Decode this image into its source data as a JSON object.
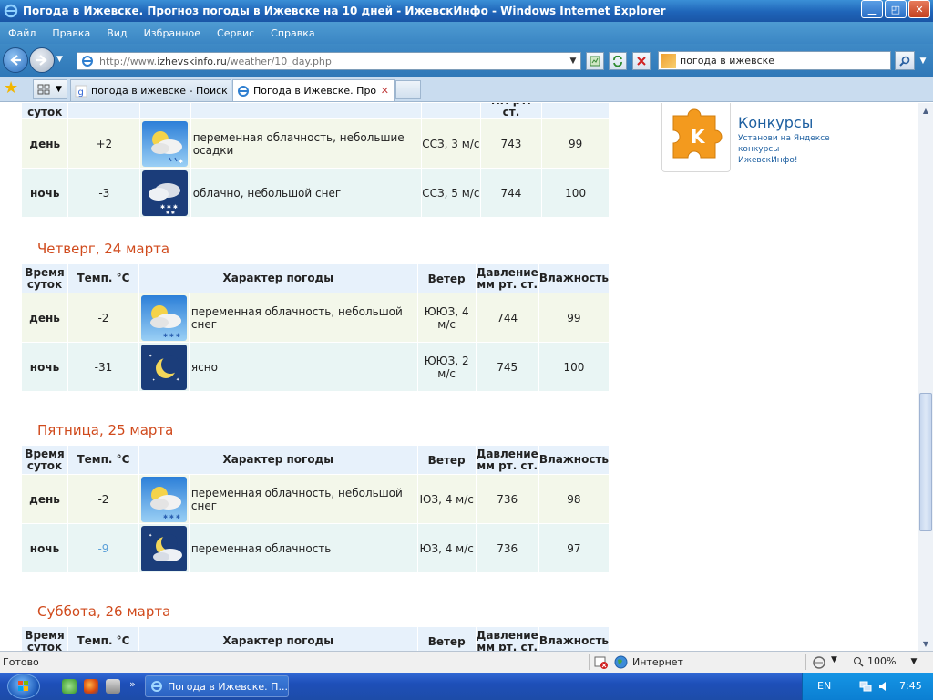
{
  "window": {
    "title": "Погода в Ижевске. Прогноз погоды в Ижевске на 10 дней - ИжевскИнфо - Windows Internet Explorer",
    "minimize": "▁",
    "maximize": "◰",
    "close": "✕"
  },
  "menu": [
    "Файл",
    "Правка",
    "Вид",
    "Избранное",
    "Сервис",
    "Справка"
  ],
  "address": {
    "url_prefix": "http://www.",
    "url_domain": "izhevskinfo.ru",
    "url_path": "/weather/10_day.php",
    "search_value": "погода в ижевске"
  },
  "tabs": [
    {
      "label": "погода в ижевске - Поиск в...",
      "active": false
    },
    {
      "label": "Погода в Ижевске. Прог...",
      "active": true
    }
  ],
  "widget": {
    "letter": "K",
    "title": "Конкурсы",
    "subtitle": "Установи на Яндексе конкурсы ИжевскИнфо!"
  },
  "headers": {
    "time": "Время суток",
    "temp": "Темп. °С",
    "desc": "Характер погоды",
    "wind": "Ветер",
    "pressure": "Давление мм рт. ст.",
    "humidity": "Влажность"
  },
  "top_partial_header": {
    "time": "суток",
    "pressure": "мм рт. ст."
  },
  "days": [
    {
      "title": "",
      "rows": [
        {
          "tod": "день",
          "temp": "+2",
          "icon": "partly-cloudy-light-precip-icon",
          "desc": "переменная облачность, небольшие осадки",
          "wind": "ССЗ, 3 м/с",
          "pressure": "743",
          "humidity": "99"
        },
        {
          "tod": "ночь",
          "temp": "-3",
          "icon": "cloudy-light-snow-night-icon",
          "desc": "облачно, небольшой снег",
          "wind": "ССЗ, 5 м/с",
          "pressure": "744",
          "humidity": "100"
        }
      ]
    },
    {
      "title": "Четверг, 24 марта",
      "rows": [
        {
          "tod": "день",
          "temp": "-2",
          "icon": "partly-cloudy-light-snow-icon",
          "desc": "переменная облачность, небольшой снег",
          "wind": "ЮЮЗ, 4 м/с",
          "pressure": "744",
          "humidity": "99"
        },
        {
          "tod": "ночь",
          "temp": "-31",
          "icon": "clear-night-icon",
          "desc": "ясно",
          "wind": "ЮЮЗ, 2 м/с",
          "pressure": "745",
          "humidity": "100"
        }
      ]
    },
    {
      "title": "Пятница, 25 марта",
      "rows": [
        {
          "tod": "день",
          "temp": "-2",
          "icon": "partly-cloudy-light-snow-icon",
          "desc": "переменная облачность, небольшой снег",
          "wind": "ЮЗ, 4 м/с",
          "pressure": "736",
          "humidity": "98"
        },
        {
          "tod": "ночь",
          "temp": "-9",
          "icon": "partly-cloudy-night-icon",
          "desc": "переменная облачность",
          "wind": "ЮЗ, 4 м/с",
          "pressure": "736",
          "humidity": "97"
        }
      ]
    },
    {
      "title": "Суббота, 26 марта",
      "rows": []
    }
  ],
  "status": {
    "text": "Готово",
    "zone": "Интернет",
    "zoom": "100%"
  },
  "taskbar": {
    "task_label": "Погода в Ижевске. П...",
    "lang": "EN",
    "clock": "7:45"
  },
  "colors": {
    "day_title": "#d04a1c",
    "header_text": "#3b6fa6",
    "row_day": "#f3f7ea",
    "row_night": "#e9f5f4",
    "cold_temp": "#5a9fd8"
  }
}
